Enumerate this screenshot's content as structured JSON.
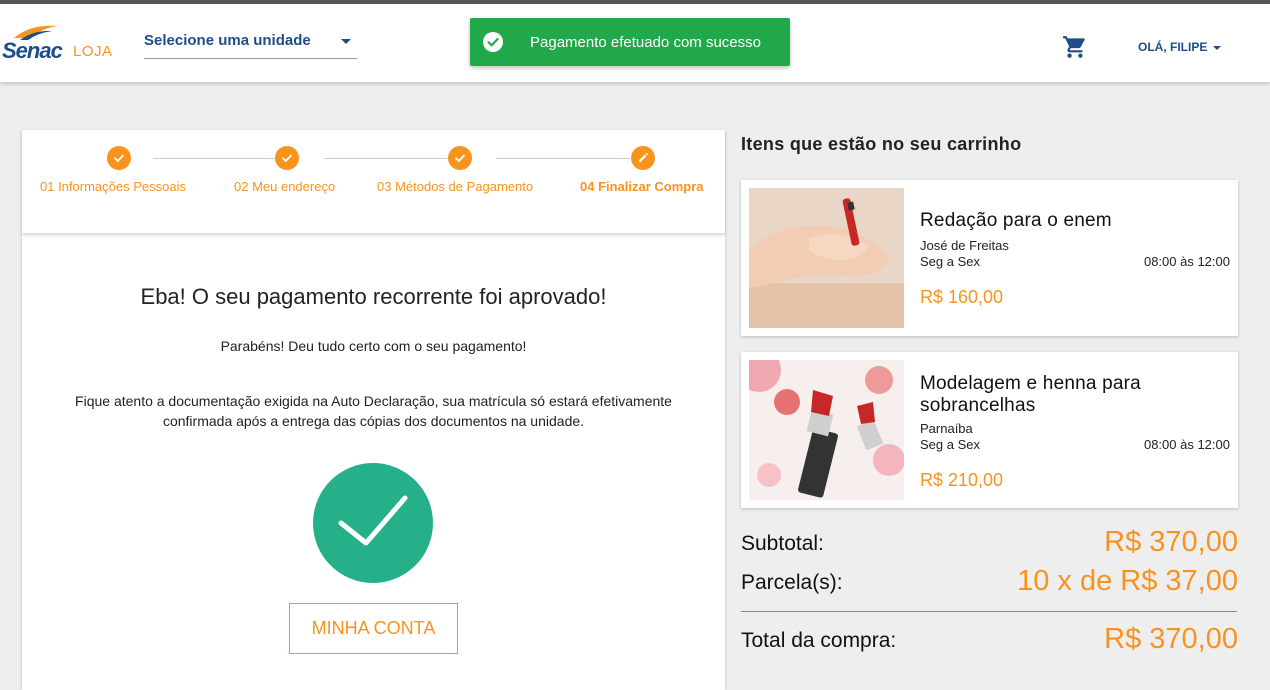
{
  "header": {
    "logo_text": "Senac",
    "logo_sub": "LOJA",
    "unit_select_label": "Selecione uma unidade",
    "toast_message": "Pagamento efetuado com sucesso",
    "user_greeting": "OLÁ, FILIPE",
    "icons": [
      "cart-icon",
      "check-circle-icon",
      "chevron-down-icon"
    ]
  },
  "stepper": {
    "steps": [
      {
        "label": "01 Informações Pessoais",
        "status": "done"
      },
      {
        "label": "02 Meu endereço",
        "status": "done"
      },
      {
        "label": "03 Métodos de Pagamento",
        "status": "done"
      },
      {
        "label": "04 Finalizar Compra",
        "status": "active"
      }
    ]
  },
  "main": {
    "title": "Eba! O seu pagamento recorrente foi aprovado!",
    "subtitle": "Parabéns! Deu tudo certo com o seu pagamento!",
    "note": "Fique atento a documentação exigida na Auto Declaração, sua matrícula só estará efetivamente confirmada após a entrega das cópias dos documentos na unidade.",
    "account_button": "MINHA CONTA"
  },
  "cart": {
    "title": "Itens que estão no seu carrinho",
    "items": [
      {
        "name": "Redação para o enem",
        "teacher": "José de Freitas",
        "days": "Seg a Sex",
        "hours": "08:00 às 12:00",
        "price": "R$ 160,00"
      },
      {
        "name": "Modelagem e henna para sobrancelhas",
        "teacher": "Parnaíba",
        "days": "Seg a Sex",
        "hours": "08:00 às 12:00",
        "price": "R$ 210,00"
      }
    ],
    "subtotal_label": "Subtotal:",
    "subtotal_value": "R$ 370,00",
    "installments_label": "Parcela(s):",
    "installments_value": "10 x de R$ 37,00",
    "total_label": "Total da compra:",
    "total_value": "R$ 370,00"
  },
  "colors": {
    "accent": "#f7931e",
    "brand": "#1d4e89",
    "success": "#21a84a",
    "check": "#26b08a"
  }
}
